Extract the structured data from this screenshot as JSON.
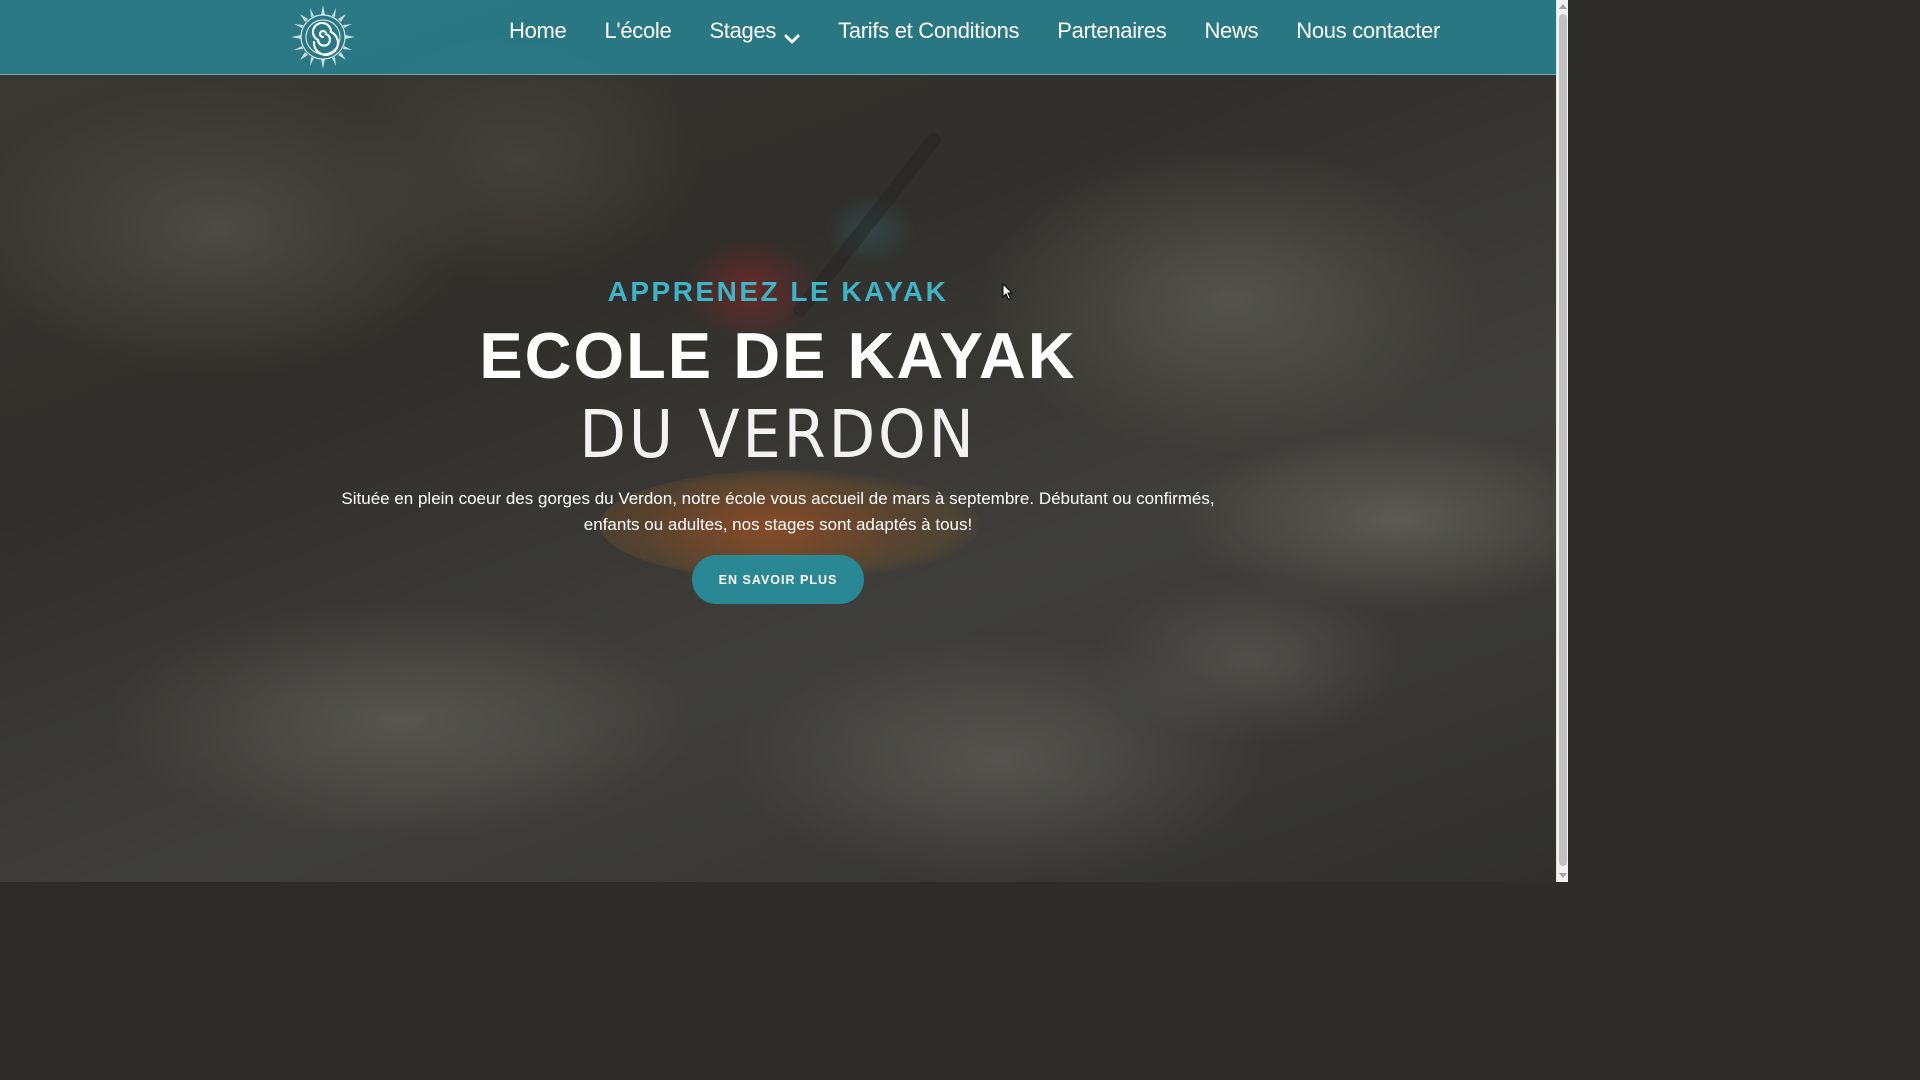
{
  "header": {
    "logo_icon": "spiral-sun-logo",
    "nav": [
      {
        "label": "Home"
      },
      {
        "label": "L'école"
      },
      {
        "label": "Stages",
        "icon": "chevron-down-icon"
      },
      {
        "label": "Tarifs et Conditions"
      },
      {
        "label": "Partenaires"
      },
      {
        "label": "News"
      },
      {
        "label": "Nous contacter"
      }
    ]
  },
  "hero": {
    "kicker": "APPRENEZ LE KAYAK",
    "title_main": "ECOLE DE KAYAK",
    "title_sub": "DU VERDON",
    "description": "Située en plein coeur des gorges du Verdon, notre école vous accueil de mars à septembre. Débutant ou confirmés, enfants ou adultes, nos stages sont adaptés à tous!",
    "cta_label": "EN SAVOIR PLUS",
    "background_image": "whitewater kayaker"
  },
  "colors": {
    "header_bg": "#287d8a",
    "accent": "#3fb4c7",
    "button_bg": "#2a8794"
  }
}
